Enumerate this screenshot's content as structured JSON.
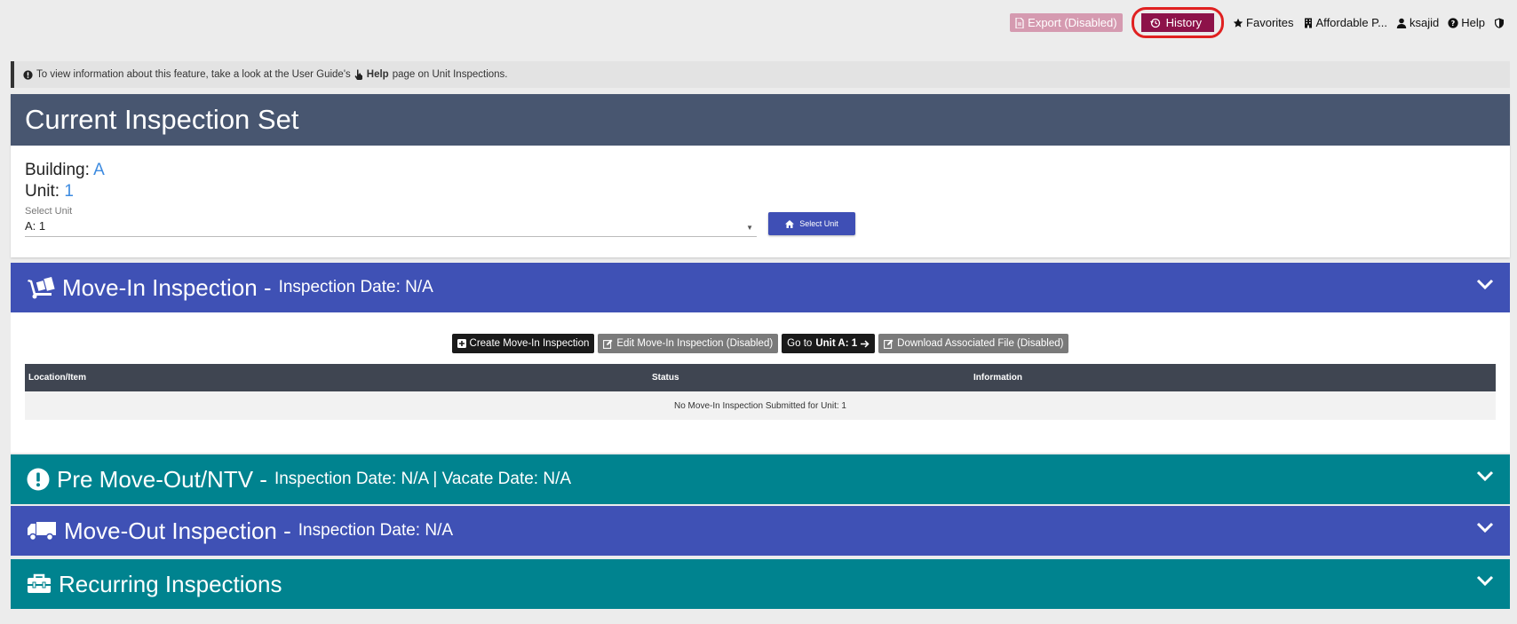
{
  "topnav": {
    "export_label": "Export (Disabled)",
    "history_label": "History",
    "favorites_label": "Favorites",
    "affordable_label": "Affordable P...",
    "user_label": "ksajid",
    "help_label": "Help"
  },
  "info": {
    "prefix": "To view information about this feature, take a look at the User Guide's",
    "help_word": "Help",
    "suffix": "page on Unit Inspections."
  },
  "current_set": {
    "title": "Current Inspection Set",
    "building_label": "Building:",
    "building_value": "A",
    "unit_label": "Unit:",
    "unit_value": "1",
    "select_label": "Select Unit",
    "select_value": "A: 1",
    "select_button": "Select Unit"
  },
  "movein": {
    "title": "Move-In Inspection -",
    "subtitle": "Inspection Date: N/A",
    "buttons": {
      "create": "Create Move-In Inspection",
      "edit": "Edit Move-In Inspection (Disabled)",
      "goto_prefix": "Go to",
      "goto_unit": "Unit A: 1",
      "download": "Download Associated File (Disabled)"
    },
    "table": {
      "columns": [
        "Location/Item",
        "Status",
        "Information"
      ],
      "empty_message": "No Move-In Inspection Submitted for Unit: 1"
    }
  },
  "premoveout": {
    "title": "Pre Move-Out/NTV -",
    "subtitle": "Inspection Date: N/A | Vacate Date: N/A"
  },
  "moveout": {
    "title": "Move-Out Inspection -",
    "subtitle": "Inspection Date: N/A"
  },
  "recurring": {
    "title": "Recurring Inspections"
  },
  "colors": {
    "blue_section": "#3f51b5",
    "teal_section": "#00838f",
    "header_slate": "#485670",
    "history_button": "#8d1249",
    "history_outline": "#e02020"
  }
}
